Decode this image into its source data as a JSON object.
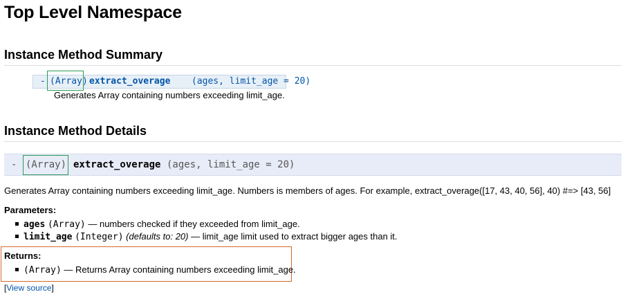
{
  "page": {
    "title": "Top Level Namespace"
  },
  "summary": {
    "heading": "Instance Method Summary",
    "visibility": "-",
    "return_type": "(Array)",
    "method_name": "extract_overage",
    "params": "(ages, limit_age = 20)",
    "doc": "Generates Array containing numbers exceeding limit_age."
  },
  "details": {
    "heading": "Instance Method Details",
    "visibility": "-",
    "return_type": "(Array)",
    "method_name": "extract_overage",
    "params": "(ages, limit_age = 20)",
    "doc": "Generates Array containing numbers exceeding limit_age. Numbers is members of ages. For example, extract_overage([17, 43, 40, 56], 40) #=> [43, 56]",
    "parameters_title": "Parameters:",
    "parameters": [
      {
        "name": "ages",
        "type": "(Array)",
        "default": "",
        "desc": "— numbers checked if they exceeded from limit_age."
      },
      {
        "name": "limit_age",
        "type": "(Integer)",
        "default": "(defaults to: 20)",
        "desc": "— limit_age limit used to extract bigger ages than it."
      }
    ],
    "returns_title": "Returns:",
    "returns": {
      "type": "(Array)",
      "desc": "— Returns Array containing numbers exceeding limit_age."
    },
    "view_source_open": "[",
    "view_source": "View source",
    "view_source_close": "]"
  }
}
